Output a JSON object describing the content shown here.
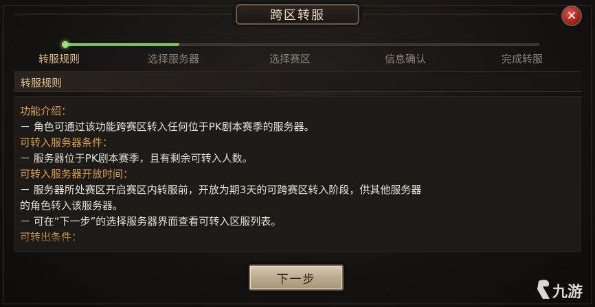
{
  "dialog": {
    "title": "跨区转服",
    "close_icon": "close-icon"
  },
  "steps": [
    {
      "label": "转服规则",
      "active": true
    },
    {
      "label": "选择服务器",
      "active": false
    },
    {
      "label": "选择赛区",
      "active": false
    },
    {
      "label": "信息确认",
      "active": false
    },
    {
      "label": "完成转服",
      "active": false
    }
  ],
  "progress": {
    "fraction": 0.24,
    "active_color": "#7bbf5a"
  },
  "section": {
    "title": "转服规则"
  },
  "rules": [
    {
      "type": "heading",
      "text": "功能介绍："
    },
    {
      "type": "body",
      "text": "－ 角色可通过该功能跨赛区转入任何位于PK剧本赛季的服务器。"
    },
    {
      "type": "heading",
      "text": "可转入服务器条件："
    },
    {
      "type": "body",
      "text": "－ 服务器位于PK剧本赛季，且有剩余可转入人数。"
    },
    {
      "type": "heading",
      "text": "可转入服务器开放时间："
    },
    {
      "type": "body",
      "text": "－ 服务器所处赛区开启赛区内转服前，开放为期3天的可跨赛区转入阶段，供其他服务器"
    },
    {
      "type": "body",
      "text": "的角色转入该服务器。"
    },
    {
      "type": "body",
      "text": "－ 可在“下一步”的选择服务器界面查看可转入区服列表。"
    },
    {
      "type": "heading",
      "text": "可转出条件："
    }
  ],
  "footer": {
    "next_label": "下一步"
  },
  "watermark": {
    "text": "九游"
  },
  "colors": {
    "heading": "#d9a24b",
    "body": "#e6e0d8",
    "active_step": "#dcb97c",
    "inactive_step": "#8a8079"
  }
}
